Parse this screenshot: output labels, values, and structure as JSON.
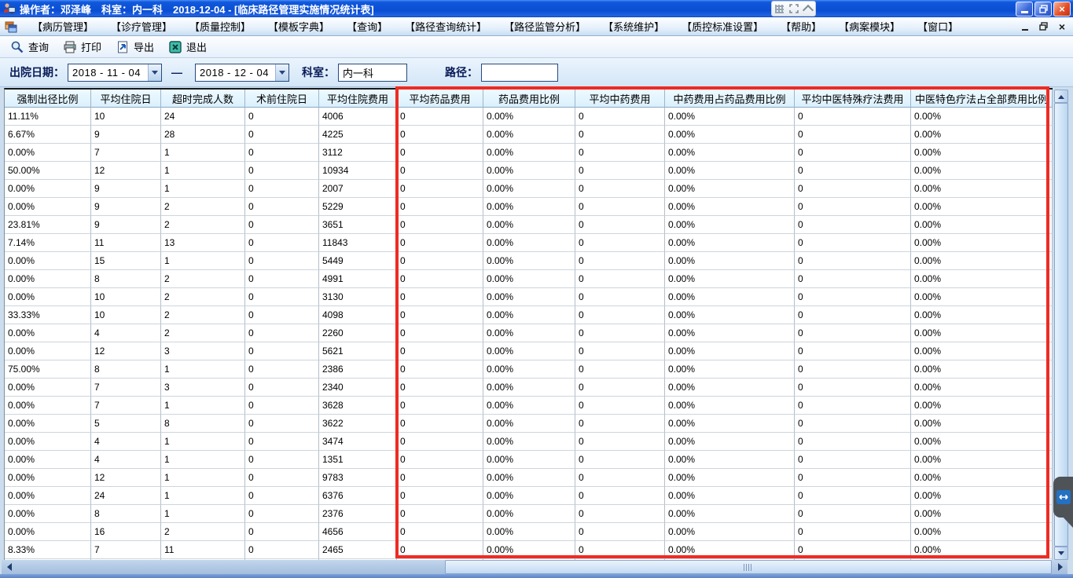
{
  "window": {
    "title": "操作者：邓泽峰　科室：内一科　2018-12-04 - [临床路径管理实施情况统计表]"
  },
  "menu": {
    "items": [
      "【病历管理】",
      "【诊疗管理】",
      "【质量控制】",
      "【模板字典】",
      "【查询】",
      "【路径查询统计】",
      "【路径监管分析】",
      "【系统维护】",
      "【质控标准设置】",
      "【帮助】",
      "【病案模块】",
      "【窗口】"
    ]
  },
  "toolbar": {
    "query": "查询",
    "print": "打印",
    "export": "导出",
    "exit": "退出"
  },
  "filters": {
    "discharge_date_label": "出院日期：",
    "date_from": "2018 - 11 - 04",
    "date_to": "2018 - 12 - 04",
    "range_separator": "—",
    "dept_label": "科室：",
    "dept_value": "内一科",
    "path_label": "路径：",
    "path_value": ""
  },
  "table": {
    "columns": [
      "强制出径比例",
      "平均住院日",
      "超时完成人数",
      "术前住院日",
      "平均住院费用",
      "平均药品费用",
      "药品费用比例",
      "平均中药费用",
      "中药费用占药品费用比例",
      "平均中医特殊疗法费用",
      "中医特色疗法占全部费用比例"
    ],
    "rows": [
      [
        "11.11%",
        "10",
        "24",
        "0",
        "4006",
        "0",
        "0.00%",
        "0",
        "0.00%",
        "0",
        "0.00%"
      ],
      [
        "6.67%",
        "9",
        "28",
        "0",
        "4225",
        "0",
        "0.00%",
        "0",
        "0.00%",
        "0",
        "0.00%"
      ],
      [
        "0.00%",
        "7",
        "1",
        "0",
        "3112",
        "0",
        "0.00%",
        "0",
        "0.00%",
        "0",
        "0.00%"
      ],
      [
        "50.00%",
        "12",
        "1",
        "0",
        "10934",
        "0",
        "0.00%",
        "0",
        "0.00%",
        "0",
        "0.00%"
      ],
      [
        "0.00%",
        "9",
        "1",
        "0",
        "2007",
        "0",
        "0.00%",
        "0",
        "0.00%",
        "0",
        "0.00%"
      ],
      [
        "0.00%",
        "9",
        "2",
        "0",
        "5229",
        "0",
        "0.00%",
        "0",
        "0.00%",
        "0",
        "0.00%"
      ],
      [
        "23.81%",
        "9",
        "2",
        "0",
        "3651",
        "0",
        "0.00%",
        "0",
        "0.00%",
        "0",
        "0.00%"
      ],
      [
        "7.14%",
        "11",
        "13",
        "0",
        "11843",
        "0",
        "0.00%",
        "0",
        "0.00%",
        "0",
        "0.00%"
      ],
      [
        "0.00%",
        "15",
        "1",
        "0",
        "5449",
        "0",
        "0.00%",
        "0",
        "0.00%",
        "0",
        "0.00%"
      ],
      [
        "0.00%",
        "8",
        "2",
        "0",
        "4991",
        "0",
        "0.00%",
        "0",
        "0.00%",
        "0",
        "0.00%"
      ],
      [
        "0.00%",
        "10",
        "2",
        "0",
        "3130",
        "0",
        "0.00%",
        "0",
        "0.00%",
        "0",
        "0.00%"
      ],
      [
        "33.33%",
        "10",
        "2",
        "0",
        "4098",
        "0",
        "0.00%",
        "0",
        "0.00%",
        "0",
        "0.00%"
      ],
      [
        "0.00%",
        "4",
        "2",
        "0",
        "2260",
        "0",
        "0.00%",
        "0",
        "0.00%",
        "0",
        "0.00%"
      ],
      [
        "0.00%",
        "12",
        "3",
        "0",
        "5621",
        "0",
        "0.00%",
        "0",
        "0.00%",
        "0",
        "0.00%"
      ],
      [
        "75.00%",
        "8",
        "1",
        "0",
        "2386",
        "0",
        "0.00%",
        "0",
        "0.00%",
        "0",
        "0.00%"
      ],
      [
        "0.00%",
        "7",
        "3",
        "0",
        "2340",
        "0",
        "0.00%",
        "0",
        "0.00%",
        "0",
        "0.00%"
      ],
      [
        "0.00%",
        "7",
        "1",
        "0",
        "3628",
        "0",
        "0.00%",
        "0",
        "0.00%",
        "0",
        "0.00%"
      ],
      [
        "0.00%",
        "5",
        "8",
        "0",
        "3622",
        "0",
        "0.00%",
        "0",
        "0.00%",
        "0",
        "0.00%"
      ],
      [
        "0.00%",
        "4",
        "1",
        "0",
        "3474",
        "0",
        "0.00%",
        "0",
        "0.00%",
        "0",
        "0.00%"
      ],
      [
        "0.00%",
        "4",
        "1",
        "0",
        "1351",
        "0",
        "0.00%",
        "0",
        "0.00%",
        "0",
        "0.00%"
      ],
      [
        "0.00%",
        "12",
        "1",
        "0",
        "9783",
        "0",
        "0.00%",
        "0",
        "0.00%",
        "0",
        "0.00%"
      ],
      [
        "0.00%",
        "24",
        "1",
        "0",
        "6376",
        "0",
        "0.00%",
        "0",
        "0.00%",
        "0",
        "0.00%"
      ],
      [
        "0.00%",
        "8",
        "1",
        "0",
        "2376",
        "0",
        "0.00%",
        "0",
        "0.00%",
        "0",
        "0.00%"
      ],
      [
        "0.00%",
        "16",
        "2",
        "0",
        "4656",
        "0",
        "0.00%",
        "0",
        "0.00%",
        "0",
        "0.00%"
      ],
      [
        "8.33%",
        "7",
        "11",
        "0",
        "2465",
        "0",
        "0.00%",
        "0",
        "0.00%",
        "0",
        "0.00%"
      ]
    ]
  },
  "annotations": {
    "highlight_color": "#ee2b24"
  },
  "icons": {
    "app_icon": "medical-operator-icon",
    "menu_form_icon": "window-form-icon",
    "query_icon": "magnifier-icon",
    "print_icon": "printer-icon",
    "export_icon": "page-export-arrow-icon",
    "exit_icon": "close-box-icon",
    "title_overlay_icons": [
      "grid-dots-icon",
      "expand-arrows-icon",
      "chevron-up-icon"
    ],
    "remote_tab_icon": "double-arrow-icon"
  }
}
